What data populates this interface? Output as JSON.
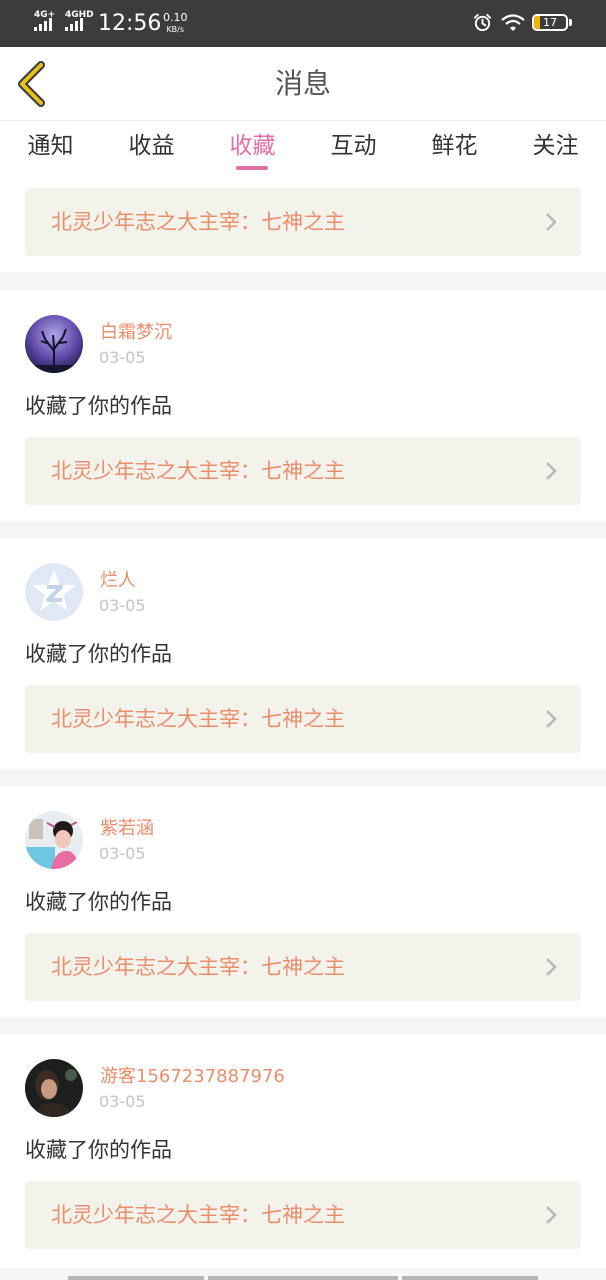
{
  "status_bar": {
    "network_1": "4G+",
    "network_2": "4GHD",
    "time": "12:56",
    "speed_value": "0.10",
    "speed_unit": "KB/s",
    "battery": "17",
    "icons": [
      "signal-icon",
      "alarm-icon",
      "wifi-icon",
      "battery-icon"
    ]
  },
  "header": {
    "title": "消息",
    "back_icon": "chevron-left-icon",
    "accent_color": "#e7c21c"
  },
  "tabs": [
    {
      "label": "通知",
      "active": false
    },
    {
      "label": "收益",
      "active": false
    },
    {
      "label": "收藏",
      "active": true
    },
    {
      "label": "互动",
      "active": false
    },
    {
      "label": "鲜花",
      "active": false
    },
    {
      "label": "关注",
      "active": false
    }
  ],
  "colors": {
    "active_tab": "#e06fa4",
    "link_text": "#e88e6a",
    "link_bg": "#f3f3ec"
  },
  "top_card": {
    "work_title": "北灵少年志之大主宰：七神之主"
  },
  "notifications": [
    {
      "username": "白霜梦沉",
      "date": "03-05",
      "action": "收藏了你的作品",
      "work_title": "北灵少年志之大主宰：七神之主",
      "avatar": "night-tree-avatar"
    },
    {
      "username": "烂人",
      "date": "03-05",
      "action": "收藏了你的作品",
      "work_title": "北灵少年志之大主宰：七神之主",
      "avatar": "default-z-avatar"
    },
    {
      "username": "紫若涵",
      "date": "03-05",
      "action": "收藏了你的作品",
      "work_title": "北灵少年志之大主宰：七神之主",
      "avatar": "costume-photo-avatar"
    },
    {
      "username": "游客1567237887976",
      "date": "03-05",
      "action": "收藏了你的作品",
      "work_title": "北灵少年志之大主宰：七神之主",
      "avatar": "dark-photo-avatar"
    }
  ]
}
